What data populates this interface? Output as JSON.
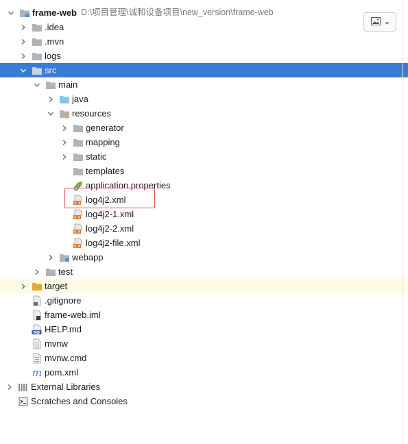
{
  "project": {
    "name": "frame-web",
    "path": "D:\\项目管理\\诚和设备项目\\new_version\\frame-web"
  },
  "tree": {
    "idea": ".idea",
    "mvn": ".mvn",
    "logs": "logs",
    "src": "src",
    "main": "main",
    "java": "java",
    "resources": "resources",
    "generator": "generator",
    "mapping": "mapping",
    "static": "static",
    "templates": "templates",
    "application_properties": "application.properties",
    "log4j2": "log4j2.xml",
    "log4j2_1": "log4j2-1.xml",
    "log4j2_2": "log4j2-2.xml",
    "log4j2_file": "log4j2-file.xml",
    "webapp": "webapp",
    "test": "test",
    "target": "target",
    "gitignore": ".gitignore",
    "iml": "frame-web.iml",
    "help": "HELP.md",
    "mvnw": "mvnw",
    "mvnw_cmd": "mvnw.cmd",
    "pom": "pom.xml",
    "external_libraries": "External Libraries",
    "scratches": "Scratches and Consoles"
  },
  "icons": {
    "folder": "folder-icon",
    "xml": "xml-file-icon",
    "properties": "spring-properties-icon",
    "maven": "maven-icon",
    "markdown": "markdown-icon",
    "library": "library-icon",
    "scratches": "scratches-icon",
    "image_menu": "image-icon"
  },
  "colors": {
    "selection": "#3a7bd5",
    "excluded_bg": "#fdfbe6",
    "highlight_box": "#d9534f",
    "folder": "#aeb4ba",
    "source_folder": "#85c5f0",
    "excluded_folder": "#e0a838",
    "xml_badge": "#e07b39"
  }
}
